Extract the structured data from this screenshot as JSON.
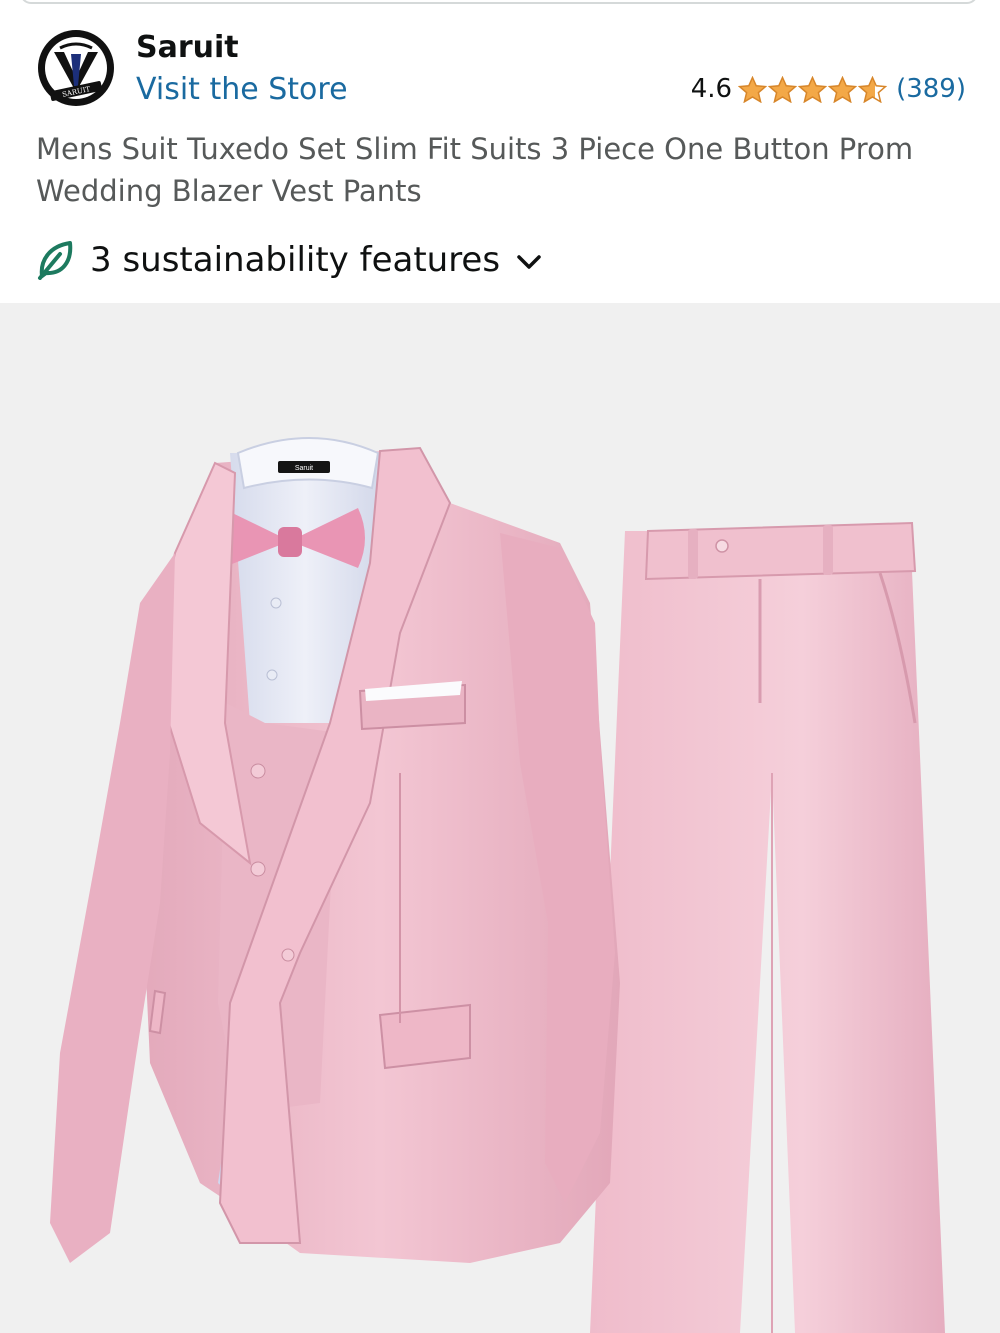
{
  "brand": {
    "name": "Saruit",
    "store_link": "Visit the Store",
    "logo_text": "SARUIT"
  },
  "rating": {
    "value": "4.6",
    "stars": 4.6,
    "count": "(389)"
  },
  "product": {
    "title": "Mens Suit Tuxedo Set Slim Fit Suits 3 Piece One Button Prom Wedding Blazer Vest Pants",
    "collar_label": "Saruit"
  },
  "sustainability": {
    "label": "3 sustainability features",
    "icon": "leaf-icon",
    "toggle_icon": "chevron-down-icon"
  },
  "colors": {
    "link": "#1a6aa0",
    "star": "#f3a847",
    "leaf": "#1d7a5f",
    "suit": "#efbccb",
    "background": "#f0f0f0"
  }
}
